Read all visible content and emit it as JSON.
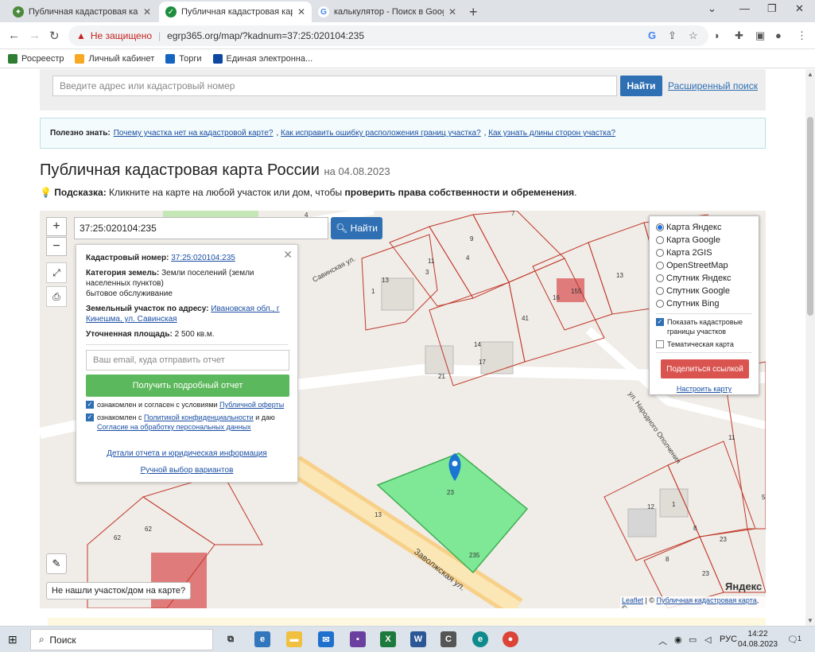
{
  "browser": {
    "tabs": [
      {
        "label": "Публичная кадастровая карта",
        "icon": "rosreestr-icon",
        "active": false
      },
      {
        "label": "Публичная кадастровая карта -",
        "icon": "check-icon",
        "active": true
      },
      {
        "label": "калькулятор - Поиск в Google",
        "icon": "google-icon",
        "active": false
      }
    ],
    "new_tab": "+",
    "not_secure": "Не защищено",
    "url": "egrp365.org/map/?kadnum=37:25:020104:235",
    "bookmarks": [
      "Росреестр",
      "Личный кабинет",
      "Торги",
      "Единая электронна..."
    ]
  },
  "page": {
    "search_placeholder": "Введите адрес или кадастровый номер",
    "search_button": "Найти",
    "advanced_search": "Расширенный поиск",
    "info_label": "Полезно знать:",
    "info_links": [
      "Почему участка нет на кадастровой карте?",
      "Как исправить ошибку расположения границ участка?",
      "Как узнать длины сторон участка?"
    ],
    "title": "Публичная кадастровая карта России",
    "title_date": "на 04.08.2023",
    "hint_label": "Подсказка:",
    "hint_text": "Кликните на карте на любой участок или дом, чтобы",
    "hint_bold": "проверить права собственности и обременения",
    "hint_end": "."
  },
  "map": {
    "cadastral_number": "37:25:020104:235",
    "find_button": "Найти",
    "zoom_in": "+",
    "zoom_out": "−",
    "popup": {
      "cad_label": "Кадастровый номер:",
      "cad_value": "37:25:020104:235",
      "category_label": "Категория земель:",
      "category_value": "Земли поселений (земли населенных пунктов)",
      "category_use": "бытовое обслуживание",
      "address_label": "Земельный участок по адресу:",
      "address_value": "Ивановская обл., г Кинешма, ул. Савинская",
      "area_label": "Уточненная площадь:",
      "area_value": "2 500 кв.м.",
      "email_placeholder": "Ваш email, куда отправить отчет",
      "report_button": "Получить подробный отчет",
      "agree1_text": "ознакомлен и согласен с условиями",
      "agree1_link": "Публичной оферты",
      "agree2_text": "ознакомлен с",
      "agree2_link": "Политикой конфиденциальности",
      "agree2_text2": "и даю",
      "agree2_link2": "Согласие на обработку персональных данных",
      "details_link": "Детали отчета и юридическая информация",
      "manual_link": "Ручной выбор вариантов"
    },
    "layers": {
      "options": [
        "Карта Яндекс",
        "Карта Google",
        "Карта 2GIS",
        "OpenStreetMap",
        "Спутник Яндекс",
        "Спутник Google",
        "Спутник Bing"
      ],
      "selected": "Карта Яндекс",
      "show_borders": "Показать кадастровые границы участков",
      "thematic": "Тематическая карта",
      "share_button": "Поделиться ссылкой",
      "configure": "Настроить карту"
    },
    "not_found": "Не нашли участок/дом на карте?",
    "attribution_leaflet": "Leaflet",
    "attribution_sep": "|",
    "attribution_pkk": "Публичная кадастровая карта",
    "yandex_logo": "Яндекс",
    "streets": [
      "Савинская ул.",
      "ул. Народного Ополчения",
      "Заволжская ул."
    ],
    "parcel_labels": [
      "13",
      "1",
      "11",
      "3",
      "9",
      "4",
      "7",
      "4",
      "16",
      "155",
      "14",
      "13",
      "41",
      "14",
      "17",
      "21",
      "11",
      "5",
      "12",
      "1",
      "8",
      "23",
      "8",
      "23",
      "62",
      "62",
      "13",
      "235",
      "23"
    ]
  },
  "taskbar": {
    "search": "Поиск",
    "lang": "РУС",
    "time": "14:22",
    "date": "04.08.2023",
    "notif": "1"
  }
}
